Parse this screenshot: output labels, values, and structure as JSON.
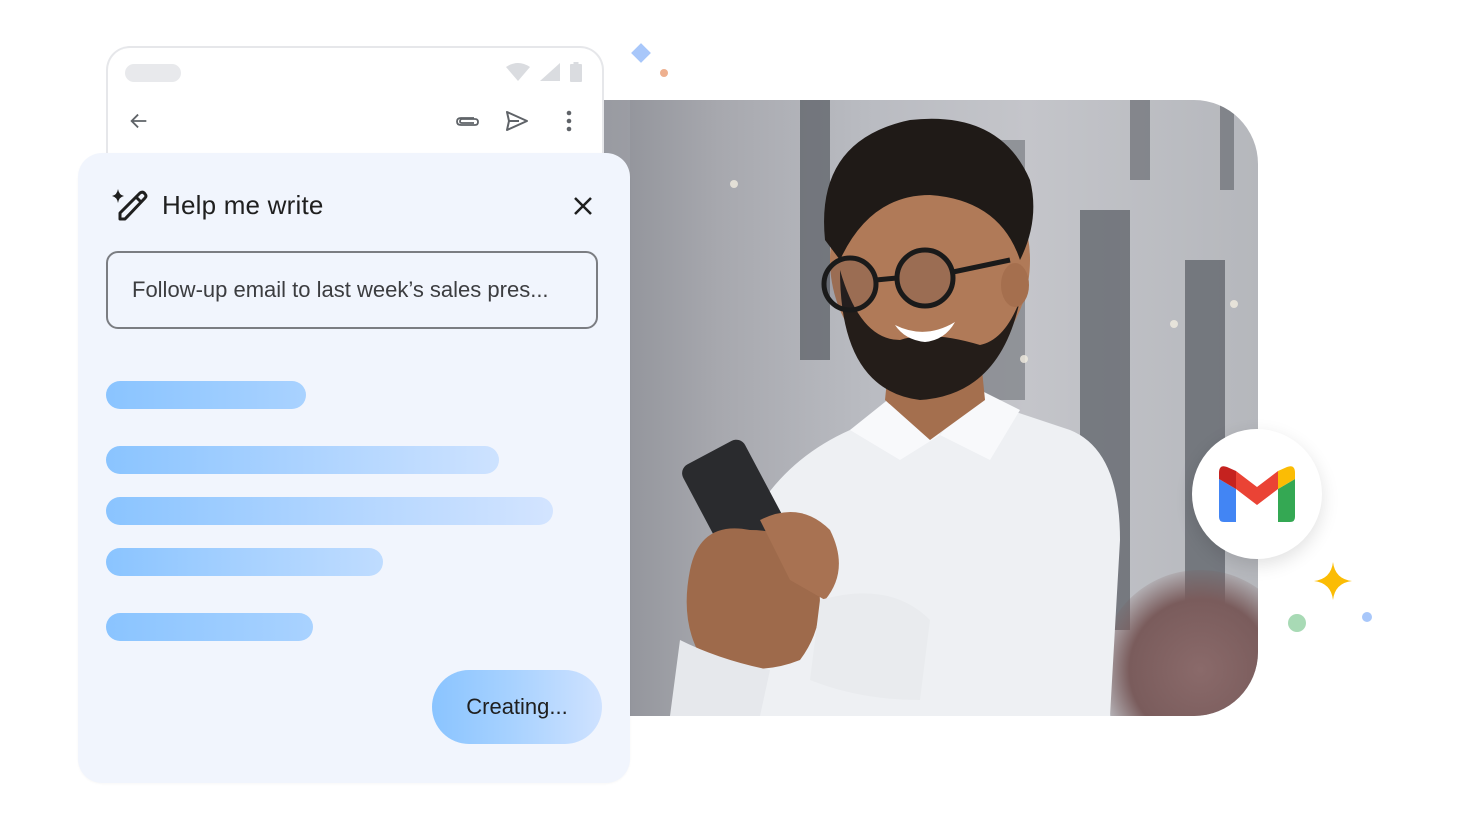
{
  "phone": {
    "status_icons": [
      "wifi-icon",
      "signal-icon",
      "battery-icon"
    ],
    "toolbar": {
      "back_icon": "arrow-left-icon",
      "attach_icon": "paperclip-icon",
      "send_icon": "send-icon",
      "more_icon": "more-vertical-icon"
    }
  },
  "panel": {
    "icon": "sparkle-pencil-icon",
    "title": "Help me write",
    "close_icon": "close-icon",
    "prompt_value": "Follow-up email to last week’s sales pres...",
    "placeholder_lines": 5,
    "button_label": "Creating..."
  },
  "badge": {
    "app": "Gmail",
    "icon": "gmail-logo-icon"
  },
  "colors": {
    "panel_bg": "#f1f5fd",
    "skeleton_start": "#8ac4ff",
    "skeleton_end": "#d0e3ff",
    "gmail_red": "#ea4335",
    "gmail_dark_red": "#c5221f",
    "gmail_blue": "#4285f4",
    "gmail_green": "#34a853",
    "gmail_yellow": "#fbbc04",
    "sparkle_yellow": "#fbbc04"
  }
}
